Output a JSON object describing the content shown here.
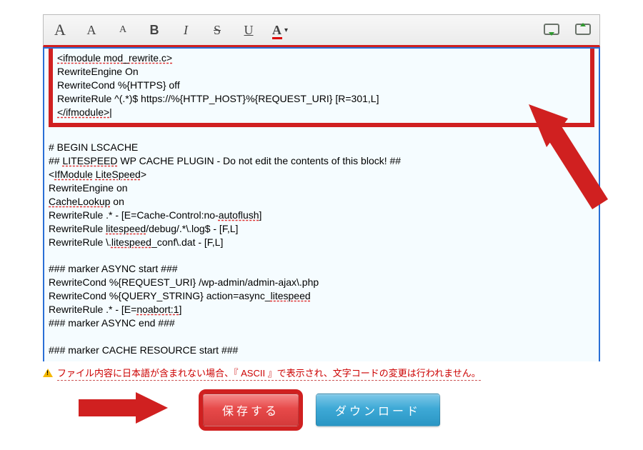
{
  "toolbar": {
    "fontsize_inc": "A",
    "fontsize_med": "A",
    "fontsize_dec": "A",
    "bold": "B",
    "italic": "I",
    "strike": "S",
    "underline": "U",
    "fgcolor_letter": "A",
    "fgcolor_caret": "▾"
  },
  "code_top": [
    "<ifmodule mod_rewrite.c>",
    "RewriteEngine On",
    "RewriteCond %{HTTPS} off",
    "RewriteRule ^(.*)$ https://%{HTTP_HOST}%{REQUEST_URI} [R=301,L]",
    "</ifmodule>"
  ],
  "code_rest": [
    "",
    "# BEGIN LSCACHE",
    "## LITESPEED WP CACHE PLUGIN - Do not edit the contents of this block! ##",
    "<IfModule LiteSpeed>",
    "RewriteEngine on",
    "CacheLookup on",
    "RewriteRule .* - [E=Cache-Control:no-autoflush]",
    "RewriteRule litespeed/debug/.*\\.log$ - [F,L]",
    "RewriteRule \\.litespeed_conf\\.dat - [F,L]",
    "",
    "### marker ASYNC start ###",
    "RewriteCond %{REQUEST_URI} /wp-admin/admin-ajax\\.php",
    "RewriteCond %{QUERY_STRING} action=async_litespeed",
    "RewriteRule .* - [E=noabort:1]",
    "### marker ASYNC end ###",
    "",
    "### marker CACHE RESOURCE start ###"
  ],
  "warning": {
    "text": "ファイル内容に日本語が含まれない場合、『 ASCII 』で表示され、文字コードの変更は行われません。"
  },
  "buttons": {
    "save": "保存する",
    "download": "ダウンロード"
  }
}
